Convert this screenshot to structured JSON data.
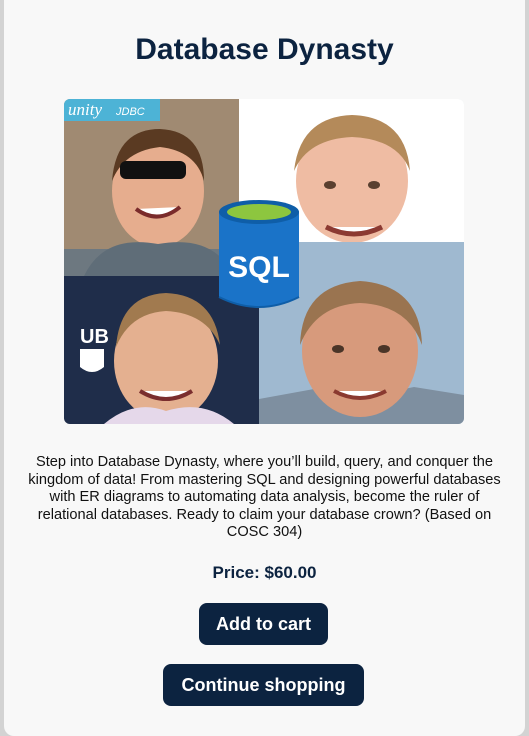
{
  "product": {
    "title": "Database Dynasty",
    "description": "Step into Database Dynasty, where you’ll build, query, and conquer the kingdom of data! From mastering SQL and designing powerful databases with ER diagrams to automating data analysis, become the ruler of relational databases. Ready to claim your database crown? (Based on COSC 304)",
    "price_label": "Price: $60.00"
  },
  "image": {
    "logo_text": "unity",
    "logo_suffix": "JDBC",
    "badge_text": "SQL",
    "crest_text": "UB"
  },
  "actions": {
    "add_to_cart": "Add to cart",
    "continue_shopping": "Continue shopping"
  },
  "colors": {
    "navy": "#0c2340",
    "card_bg": "#f8f8f8",
    "sql_blue": "#1a73c8",
    "sql_green": "#8dc63f"
  }
}
